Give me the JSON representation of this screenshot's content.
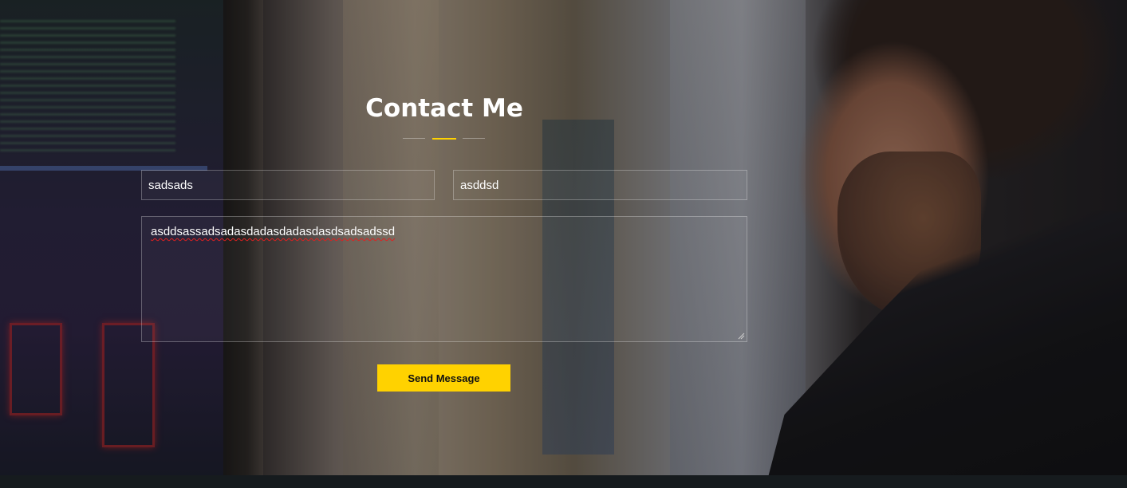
{
  "contact": {
    "title": "Contact Me",
    "accent_color": "#ffd200",
    "name_value": "sadsads",
    "email_value": "asddsd",
    "message_value": "asddsassadsadasdadasdadasdasdsadsadssd",
    "send_label": "Send Message"
  }
}
